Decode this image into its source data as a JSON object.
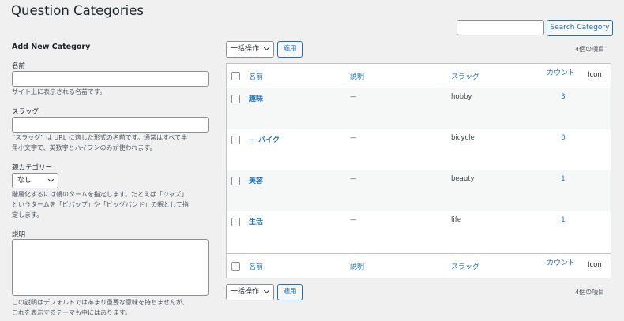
{
  "page": {
    "title": "Question Categories"
  },
  "search": {
    "placeholder": "",
    "button_label": "Search Category"
  },
  "form": {
    "heading": "Add New Category",
    "name_label": "名前",
    "name_desc": "サイト上に表示される名前です。",
    "slug_label": "スラッグ",
    "slug_desc_1": "“スラッグ” は URL に適した形式の名前です。通常はすべて半",
    "slug_desc_2": "角小文字で、英数字とハイフンのみが使われます。",
    "parent_label": "親カテゴリー",
    "parent_value": "なし",
    "parent_desc_1": "階層化するには親のタームを指定します。たとえば「ジャズ」",
    "parent_desc_2": "というタームを「ビバップ」や「ビッグバンド」の親として指",
    "parent_desc_3": "定します。",
    "description_label": "説明",
    "description_desc_1": "この説明はデフォルトではあまり重要な意味を持ちませんが、",
    "description_desc_2": "これを表示するテーマも中にはあります。"
  },
  "bulk": {
    "select_label": "一括操作",
    "apply_label": "適用",
    "count_text": "4個の項目"
  },
  "table": {
    "columns": {
      "name": "名前",
      "description": "説明",
      "slug": "スラッグ",
      "count": "カウント",
      "icon": "Icon"
    },
    "rows": [
      {
        "name": "趣味",
        "description": "—",
        "slug": "hobby",
        "count": "3"
      },
      {
        "name": "— バイク",
        "description": "—",
        "slug": "bicycle",
        "count": "0"
      },
      {
        "name": "美容",
        "description": "—",
        "slug": "beauty",
        "count": "1"
      },
      {
        "name": "生活",
        "description": "—",
        "slug": "life",
        "count": "1"
      }
    ]
  },
  "colors": {
    "accent": "#2271b1",
    "background": "#f0f0f1",
    "border": "#c3c4c7"
  }
}
